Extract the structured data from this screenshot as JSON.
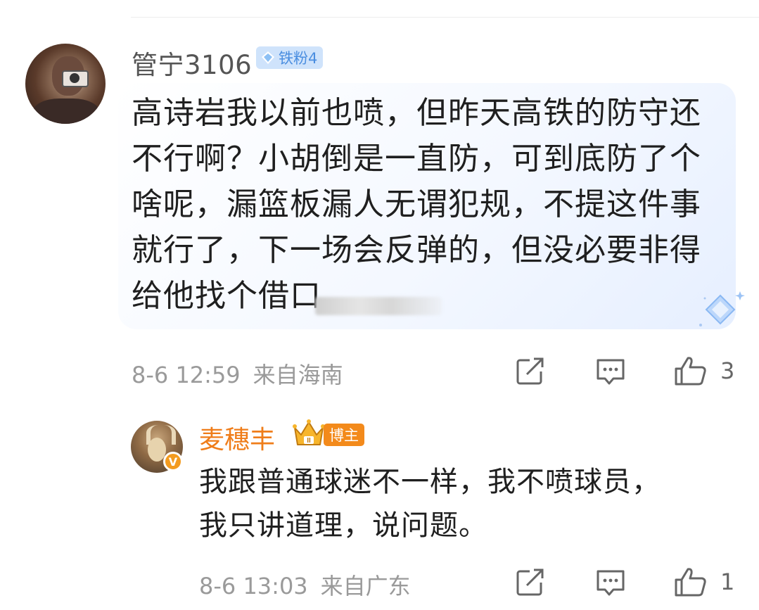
{
  "main_comment": {
    "username": "管宁3106",
    "badge": "铁粉4",
    "text_lines": [
      "高诗岩我以前也喷，但昨天高铁的防守还",
      "不行啊？小胡倒是一直防，可到底防了个",
      "啥呢，漏篮板漏人无谓犯规，不提这件事",
      "就行了，下一场会反弹的，但没必要非得",
      "给他找个借口"
    ],
    "time": "8-6 12:59",
    "location": "来自海南",
    "like_count": "3",
    "icons": [
      "share-icon",
      "comment-icon",
      "like-icon",
      "diamond-decoration-icon"
    ]
  },
  "reply": {
    "username": "麦穗丰",
    "badge": "博主",
    "verified_mark": "V",
    "crown_level": "II",
    "text_lines": [
      "我跟普通球迷不一样，我不喷球员，",
      "我只讲道理，说问题。"
    ],
    "time": "8-6 13:03",
    "location": "来自广东",
    "like_count": "1",
    "icons": [
      "share-icon",
      "comment-icon",
      "like-icon"
    ]
  },
  "colors": {
    "username_gray": "#555555",
    "blogger_orange": "#ef7d1a",
    "fan_badge_blue": "#4a8ee0",
    "meta_gray": "#9a9a9a"
  }
}
